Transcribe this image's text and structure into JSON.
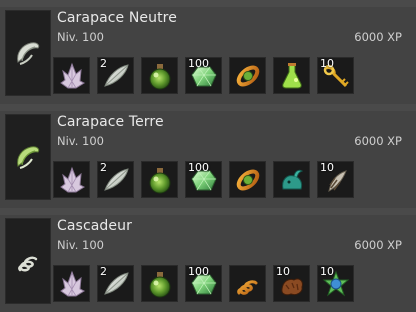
{
  "entries": [
    {
      "title": "Carapace Neutre",
      "level": "Niv. 100",
      "xp": "6000 XP",
      "icon": "neutral-shell-icon",
      "items": [
        {
          "icon": "crystal-cluster-icon",
          "qty": ""
        },
        {
          "icon": "white-feather-icon",
          "qty": "2"
        },
        {
          "icon": "green-potion-icon",
          "qty": ""
        },
        {
          "icon": "green-gem-icon",
          "qty": "100"
        },
        {
          "icon": "orange-orb-ring-icon",
          "qty": ""
        },
        {
          "icon": "green-flask-icon",
          "qty": ""
        },
        {
          "icon": "golden-key-icon",
          "qty": "10"
        }
      ]
    },
    {
      "title": "Carapace Terre",
      "level": "Niv. 100",
      "xp": "6000 XP",
      "icon": "earth-shell-icon",
      "items": [
        {
          "icon": "crystal-cluster-icon",
          "qty": ""
        },
        {
          "icon": "white-feather-icon",
          "qty": "2"
        },
        {
          "icon": "green-potion-icon",
          "qty": ""
        },
        {
          "icon": "green-gem-icon",
          "qty": "100"
        },
        {
          "icon": "orange-orb-ring-icon",
          "qty": ""
        },
        {
          "icon": "teal-creature-icon",
          "qty": ""
        },
        {
          "icon": "claw-feather-icon",
          "qty": "10"
        }
      ]
    },
    {
      "title": "Cascadeur",
      "level": "Niv. 100",
      "xp": "6000 XP",
      "icon": "coil-icon",
      "items": [
        {
          "icon": "crystal-cluster-icon",
          "qty": ""
        },
        {
          "icon": "white-feather-icon",
          "qty": "2"
        },
        {
          "icon": "green-potion-icon",
          "qty": ""
        },
        {
          "icon": "green-gem-icon",
          "qty": "100"
        },
        {
          "icon": "orange-spring-icon",
          "qty": ""
        },
        {
          "icon": "brown-fur-icon",
          "qty": "10"
        },
        {
          "icon": "blue-green-flower-icon",
          "qty": "10"
        }
      ]
    }
  ]
}
